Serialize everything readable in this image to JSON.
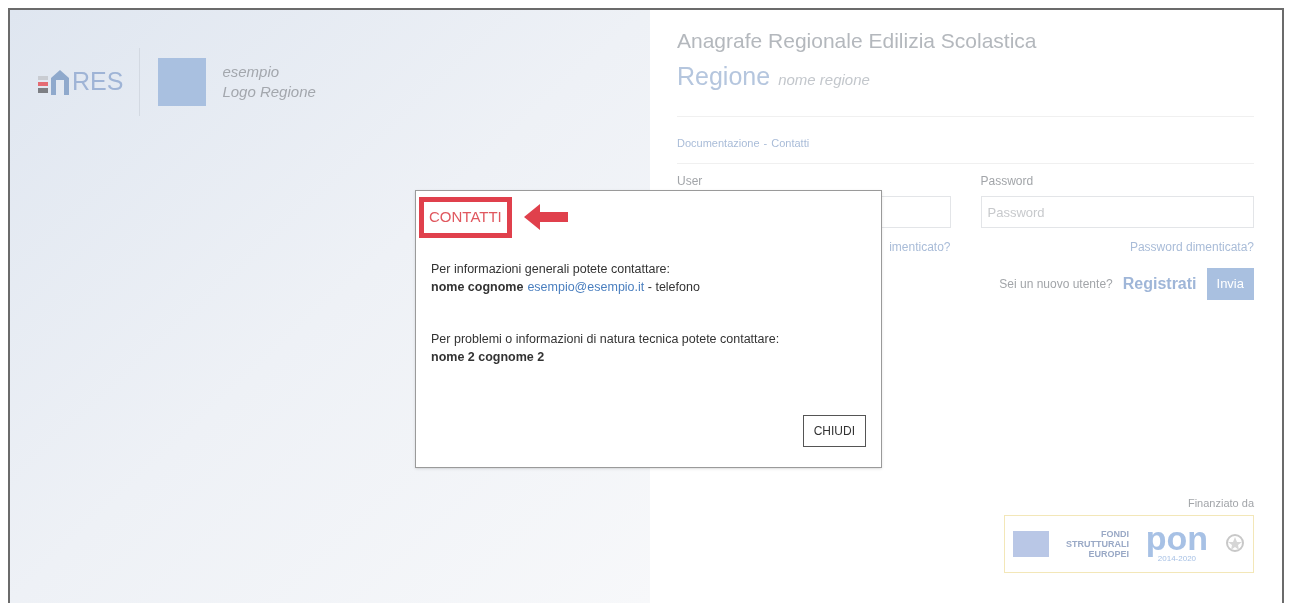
{
  "header": {
    "logo_text": "RES",
    "region_logo": [
      "esempio",
      "Logo Regione"
    ]
  },
  "app": {
    "title": "Anagrafe Regionale Edilizia Scolastica",
    "region_label": "Regione",
    "region_name": "nome regione"
  },
  "nav_links": [
    "Documentazione",
    "Contatti"
  ],
  "nav_separator": "-",
  "login": {
    "user_label": "User",
    "user_forgot": "imenticato?",
    "password_label": "Password",
    "password_placeholder": "Password",
    "password_forgot": "Password dimenticata?",
    "signup_prompt": "Sei un nuovo utente?",
    "signup_link": "Registrati",
    "submit": "Invia"
  },
  "funding": {
    "label": "Finanziato da",
    "logo_lines": [
      "FONDI",
      "STRUTTURALI",
      "EUROPEI"
    ],
    "logo_mark": "pon",
    "logo_years": "2014-2020"
  },
  "dialog": {
    "title": "CONTATTI",
    "highlighted": true,
    "sections": [
      {
        "intro": "Per informazioni generali potete contattare:",
        "name": "nome cognome",
        "email": "esempio@esempio.it",
        "extra": " - telefono"
      },
      {
        "intro": "Per problemi o informazioni di natura tecnica potete contattare:",
        "name": "nome 2 cognome 2"
      }
    ],
    "close": "CHIUDI"
  }
}
